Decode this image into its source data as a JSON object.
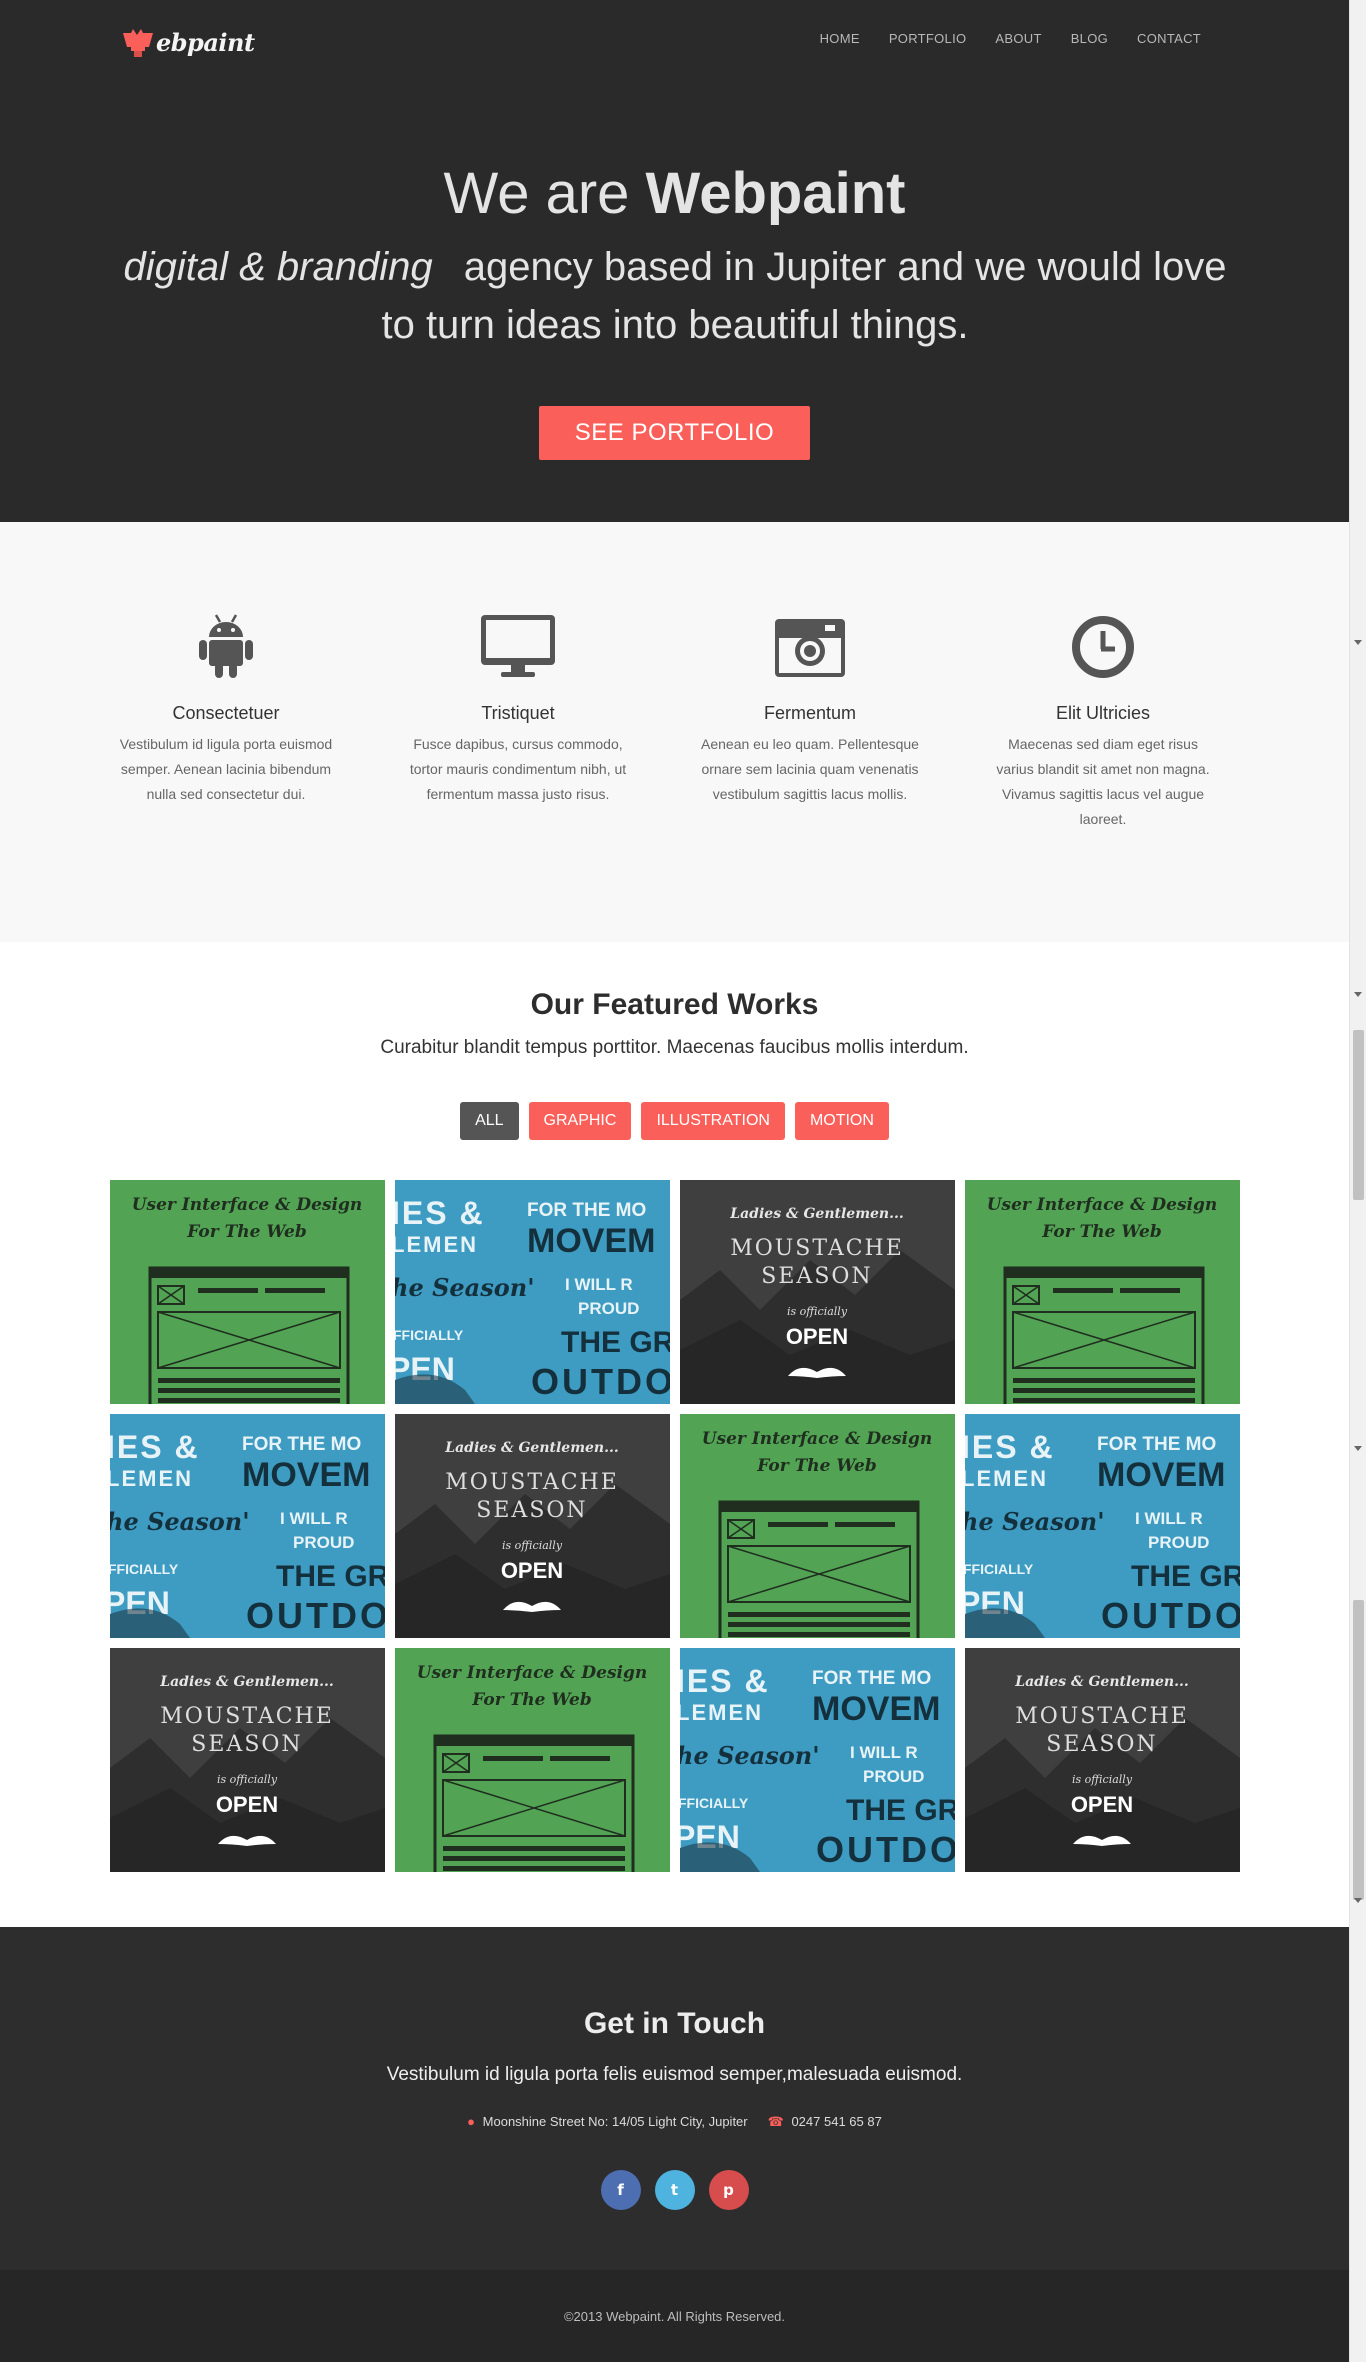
{
  "brand": {
    "logo_text": "ebpaint",
    "accent": "#fa5f5a",
    "dark": "#2a2a2a"
  },
  "nav": {
    "items": [
      "HOME",
      "PORTFOLIO",
      "ABOUT",
      "BLOG",
      "CONTACT"
    ]
  },
  "hero": {
    "title_prefix": "We are",
    "title_strong": "Webpaint",
    "sub_italic": "digital & branding",
    "sub_rest": "agency based in Jupiter and we would love to turn ideas into beautiful things.",
    "button": "SEE PORTFOLIO"
  },
  "features": [
    {
      "icon": "android-icon",
      "title": "Consectetuer",
      "text": "Vestibulum id ligula porta euismod semper. Aenean lacinia bibendum nulla sed consectetur dui."
    },
    {
      "icon": "monitor-icon",
      "title": "Tristiquet",
      "text": "Fusce dapibus, cursus commodo, tortor mauris condimentum nibh, ut fermentum massa justo risus."
    },
    {
      "icon": "camera-icon",
      "title": "Fermentum",
      "text": "Aenean eu leo quam. Pellentesque ornare sem lacinia quam venenatis vestibulum sagittis lacus mollis."
    },
    {
      "icon": "clock-icon",
      "title": "Elit Ultricies",
      "text": "Maecenas sed diam eget risus varius blandit sit amet non magna. Vivamus sagittis lacus vel augue laoreet."
    }
  ],
  "works": {
    "title": "Our Featured Works",
    "lead": "Curabitur blandit tempus porttitor. Maecenas faucibus mollis interdum.",
    "filters": [
      "ALL",
      "GRAPHIC",
      "ILLUSTRATION",
      "MOTION"
    ],
    "active_filter": "ALL",
    "tiles": [
      "ui",
      "outdoor",
      "moustache",
      "ui",
      "outdoor",
      "moustache",
      "ui",
      "outdoor",
      "moustache",
      "ui",
      "outdoor",
      "moustache"
    ],
    "tile_text": {
      "ui_line1": "User Interface & Design",
      "ui_line2": "For The Web",
      "outdoor_a": "IES &",
      "outdoor_b": "FOR THE MO",
      "outdoor_c": "LEMEN",
      "outdoor_d": "MOVEM",
      "outdoor_e": "he Season'",
      "outdoor_f": "I WILL R",
      "outdoor_g": "PROUD",
      "outdoor_h": "FFICIALLY",
      "outdoor_i": "THE GR",
      "outdoor_j": "PEN",
      "outdoor_k": "OUTDO",
      "m_line1": "Ladies & Gentlemen...",
      "m_line2": "MOUSTACHE",
      "m_line3": "SEASON",
      "m_line4": "is officially",
      "m_line5": "OPEN"
    }
  },
  "contact": {
    "title": "Get in Touch",
    "lead": "Vestibulum id ligula porta felis euismod semper,malesuada euismod.",
    "address": "Moonshine Street No: 14/05 Light City, Jupiter",
    "phone": "0247 541 65 87",
    "socials": [
      {
        "name": "facebook",
        "glyph": "f",
        "color": "#4d6eb0"
      },
      {
        "name": "twitter",
        "glyph": "t",
        "color": "#4fb3e0"
      },
      {
        "name": "pinterest",
        "glyph": "p",
        "color": "#d74c4c"
      }
    ]
  },
  "footer": {
    "copyright": "©2013 Webpaint. All Rights Reserved."
  }
}
